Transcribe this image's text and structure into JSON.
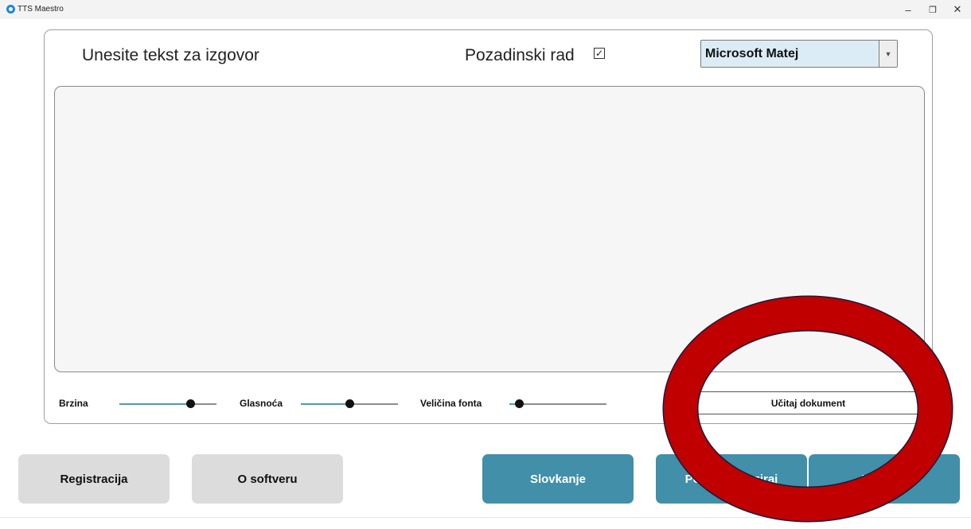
{
  "window": {
    "title": "TTS Maestro",
    "controls": {
      "minimize": "–",
      "restore": "❐",
      "close": "✕"
    }
  },
  "header": {
    "prompt_label": "Unesite tekst za izgovor",
    "background_mode_label": "Pozadinski rad",
    "background_mode_checked": true,
    "checkbox_glyph": "✓",
    "voice_select": {
      "selected": "Microsoft Matej",
      "arrow": "▼"
    }
  },
  "text_input": {
    "value": ""
  },
  "sliders": [
    {
      "label": "Brzina",
      "value_fraction": 0.73
    },
    {
      "label": "Glasnoća",
      "value_fraction": 0.5
    },
    {
      "label": "Veličina fonta",
      "value_fraction": 0.1
    }
  ],
  "load_document_label": "Učitaj dokument",
  "buttons": {
    "register": "Registracija",
    "about": "O softveru",
    "spelling": "Slovkanje",
    "start_pause": "Pokreni/Pauziraj",
    "speak": "Izgovori"
  },
  "colors": {
    "accent": "#418fa9",
    "slider_fill": "#4a9ab8",
    "select_bg": "#dcecf6",
    "annotation_ring": "#c00000"
  },
  "annotation": {
    "shape": "ring",
    "target": "Učitaj dokument"
  }
}
